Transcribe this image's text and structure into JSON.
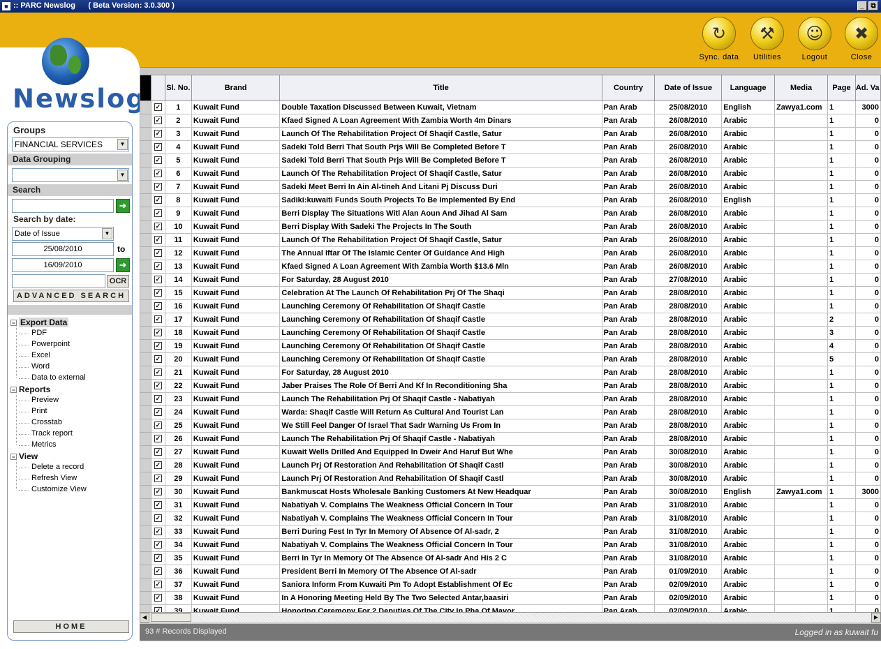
{
  "window": {
    "title": ":: PARC Newslog      ( Beta Version: 3.0.300 )",
    "minimize": "_",
    "restore": "⧉"
  },
  "toolbar": [
    {
      "label": "Sync. data",
      "icon": "sync-icon",
      "glyph": "↻"
    },
    {
      "label": "Utilities",
      "icon": "utilities-icon",
      "glyph": "⚒"
    },
    {
      "label": "Logout",
      "icon": "logout-user-icon",
      "glyph": "☺"
    },
    {
      "label": "Close",
      "icon": "close-files-icon",
      "glyph": "✖"
    }
  ],
  "logo": {
    "text": "Newslog"
  },
  "sidebar": {
    "groups_label": "Groups",
    "groups_value": "FINANCIAL SERVICES",
    "data_grouping_label": "Data Grouping",
    "data_grouping_value": "",
    "search_label": "Search",
    "search_value": "",
    "search_by_date_label": "Search by date:",
    "date_type_value": "Date of Issue",
    "date_from": "25/08/2010",
    "to_label": "to",
    "date_to": "16/09/2010",
    "ocr_value": "",
    "ocr_label": "OCR",
    "advanced_search_label": "ADVANCED SEARCH",
    "home_label": "HOME",
    "tree": {
      "export": {
        "label": "Export Data",
        "items": [
          "PDF",
          "Powerpoint",
          "Excel",
          "Word",
          "Data to external"
        ]
      },
      "reports": {
        "label": "Reports",
        "items": [
          "Preview",
          "Print",
          "Crosstab",
          "Track report",
          "Metrics"
        ]
      },
      "view": {
        "label": "View",
        "items": [
          "Delete a record",
          "Refresh View",
          "Customize View"
        ]
      }
    }
  },
  "grid": {
    "columns": [
      "Sl. No.",
      "Brand",
      "Title",
      "Country",
      "Date of Issue",
      "Language",
      "Media",
      "Page",
      "Ad. Va"
    ],
    "check_glyph": "✓",
    "rows": [
      [
        "1",
        "Kuwait Fund",
        "Double Taxation Discussed Between Kuwait, Vietnam",
        "Pan Arab",
        "25/08/2010",
        "English",
        "Zawya1.com",
        "1",
        "3000"
      ],
      [
        "2",
        "Kuwait Fund",
        "Kfaed Signed A Loan Agreement With Zambia Worth 4m Dinars",
        "Pan Arab",
        "26/08/2010",
        "Arabic",
        "",
        "1",
        "0"
      ],
      [
        "3",
        "Kuwait Fund",
        "Launch Of The Rehabilitation Project Of Shaqif Castle, Satur",
        "Pan Arab",
        "26/08/2010",
        "Arabic",
        "",
        "1",
        "0"
      ],
      [
        "4",
        "Kuwait Fund",
        "Sadeki Told Berri That South Prjs Will Be Completed Before T",
        "Pan Arab",
        "26/08/2010",
        "Arabic",
        "",
        "1",
        "0"
      ],
      [
        "5",
        "Kuwait Fund",
        "Sadeki Told Berri That South Prjs Will Be Completed Before T",
        "Pan Arab",
        "26/08/2010",
        "Arabic",
        "",
        "1",
        "0"
      ],
      [
        "6",
        "Kuwait Fund",
        "Launch Of The Rehabilitation Project Of Shaqif Castle, Satur",
        "Pan Arab",
        "26/08/2010",
        "Arabic",
        "",
        "1",
        "0"
      ],
      [
        "7",
        "Kuwait Fund",
        "Sadeki Meet Berri In Ain Al-tineh And Litani Pj Discuss Duri",
        "Pan Arab",
        "26/08/2010",
        "Arabic",
        "",
        "1",
        "0"
      ],
      [
        "8",
        "Kuwait Fund",
        "Sadiki:kuwaiti Funds South Projects To Be Implemented By End",
        "Pan Arab",
        "26/08/2010",
        "English",
        "",
        "1",
        "0"
      ],
      [
        "9",
        "Kuwait Fund",
        "Berri Display The Situations Witl Alan Aoun And Jihad Al Sam",
        "Pan Arab",
        "26/08/2010",
        "Arabic",
        "",
        "1",
        "0"
      ],
      [
        "10",
        "Kuwait Fund",
        "Berri Display With Sadeki The Projects In The South",
        "Pan Arab",
        "26/08/2010",
        "Arabic",
        "",
        "1",
        "0"
      ],
      [
        "11",
        "Kuwait Fund",
        "Launch Of The Rehabilitation Project Of Shaqif Castle, Satur",
        "Pan Arab",
        "26/08/2010",
        "Arabic",
        "",
        "1",
        "0"
      ],
      [
        "12",
        "Kuwait Fund",
        "The Annual Iftar Of The Islamic Center Of Guidance And High",
        "Pan Arab",
        "26/08/2010",
        "Arabic",
        "",
        "1",
        "0"
      ],
      [
        "13",
        "Kuwait Fund",
        "Kfaed Signed A Loan Agreement With Zambia Worth $13.6 Mln",
        "Pan Arab",
        "26/08/2010",
        "Arabic",
        "",
        "1",
        "0"
      ],
      [
        "14",
        "Kuwait Fund",
        "For Saturday, 28 August 2010",
        "Pan Arab",
        "27/08/2010",
        "Arabic",
        "",
        "1",
        "0"
      ],
      [
        "15",
        "Kuwait Fund",
        "Celebration At The Launch Of Rehabilitation Prj Of The Shaqi",
        "Pan Arab",
        "28/08/2010",
        "Arabic",
        "",
        "1",
        "0"
      ],
      [
        "16",
        "Kuwait Fund",
        "Launching Ceremony Of Rehabilitation Of Shaqif Castle",
        "Pan Arab",
        "28/08/2010",
        "Arabic",
        "",
        "1",
        "0"
      ],
      [
        "17",
        "Kuwait Fund",
        "Launching Ceremony Of Rehabilitation Of Shaqif Castle",
        "Pan Arab",
        "28/08/2010",
        "Arabic",
        "",
        "2",
        "0"
      ],
      [
        "18",
        "Kuwait Fund",
        "Launching Ceremony Of Rehabilitation Of Shaqif Castle",
        "Pan Arab",
        "28/08/2010",
        "Arabic",
        "",
        "3",
        "0"
      ],
      [
        "19",
        "Kuwait Fund",
        "Launching Ceremony Of Rehabilitation Of Shaqif Castle",
        "Pan Arab",
        "28/08/2010",
        "Arabic",
        "",
        "4",
        "0"
      ],
      [
        "20",
        "Kuwait Fund",
        "Launching Ceremony Of Rehabilitation Of Shaqif Castle",
        "Pan Arab",
        "28/08/2010",
        "Arabic",
        "",
        "5",
        "0"
      ],
      [
        "21",
        "Kuwait Fund",
        "For Saturday, 28 August 2010",
        "Pan Arab",
        "28/08/2010",
        "Arabic",
        "",
        "1",
        "0"
      ],
      [
        "22",
        "Kuwait Fund",
        "Jaber Praises The Role Of Berri And Kf In Reconditioning Sha",
        "Pan Arab",
        "28/08/2010",
        "Arabic",
        "",
        "1",
        "0"
      ],
      [
        "23",
        "Kuwait Fund",
        "Launch The Rehabilitation Prj Of Shaqif Castle - Nabatiyah",
        "Pan Arab",
        "28/08/2010",
        "Arabic",
        "",
        "1",
        "0"
      ],
      [
        "24",
        "Kuwait Fund",
        "Warda: Shaqif Castle Will Return As Cultural And Tourist Lan",
        "Pan Arab",
        "28/08/2010",
        "Arabic",
        "",
        "1",
        "0"
      ],
      [
        "25",
        "Kuwait Fund",
        "We Still Feel Danger Of Israel That Sadr Warning Us From In",
        "Pan Arab",
        "28/08/2010",
        "Arabic",
        "",
        "1",
        "0"
      ],
      [
        "26",
        "Kuwait Fund",
        "Launch The Rehabilitation Prj Of Shaqif Castle - Nabatiyah",
        "Pan Arab",
        "28/08/2010",
        "Arabic",
        "",
        "1",
        "0"
      ],
      [
        "27",
        "Kuwait Fund",
        "Kuwait Wells Drilled And Equipped In Dweir And Haruf But Whe",
        "Pan Arab",
        "30/08/2010",
        "Arabic",
        "",
        "1",
        "0"
      ],
      [
        "28",
        "Kuwait Fund",
        "Launch Prj Of Restoration And Rehabilitation Of Shaqif Castl",
        "Pan Arab",
        "30/08/2010",
        "Arabic",
        "",
        "1",
        "0"
      ],
      [
        "29",
        "Kuwait Fund",
        "Launch Prj Of Restoration And Rehabilitation Of Shaqif Castl",
        "Pan Arab",
        "30/08/2010",
        "Arabic",
        "",
        "1",
        "0"
      ],
      [
        "30",
        "Kuwait Fund",
        "Bankmuscat Hosts Wholesale Banking Customers At New Headquar",
        "Pan Arab",
        "30/08/2010",
        "English",
        "Zawya1.com",
        "1",
        "3000"
      ],
      [
        "31",
        "Kuwait Fund",
        "Nabatiyah V. Complains The Weakness Official Concern In Tour",
        "Pan Arab",
        "31/08/2010",
        "Arabic",
        "",
        "1",
        "0"
      ],
      [
        "32",
        "Kuwait Fund",
        "Nabatiyah V. Complains The Weakness Official Concern In Tour",
        "Pan Arab",
        "31/08/2010",
        "Arabic",
        "",
        "1",
        "0"
      ],
      [
        "33",
        "Kuwait Fund",
        "Berri During Fest In Tyr In Memory Of Absence Of Al-sadr, 2",
        "Pan Arab",
        "31/08/2010",
        "Arabic",
        "",
        "1",
        "0"
      ],
      [
        "34",
        "Kuwait Fund",
        "Nabatiyah V. Complains The Weakness Official Concern In Tour",
        "Pan Arab",
        "31/08/2010",
        "Arabic",
        "",
        "1",
        "0"
      ],
      [
        "35",
        "Kuwait Fund",
        "Berri In Tyr In Memory Of The Absence Of Al-sadr And His 2 C",
        "Pan Arab",
        "31/08/2010",
        "Arabic",
        "",
        "1",
        "0"
      ],
      [
        "36",
        "Kuwait Fund",
        "President Berri In Memory Of The Absence Of Al-sadr",
        "Pan Arab",
        "01/09/2010",
        "Arabic",
        "",
        "1",
        "0"
      ],
      [
        "37",
        "Kuwait Fund",
        "Saniora Inform From Kuwaiti Pm To Adopt Establishment Of Ec",
        "Pan Arab",
        "02/09/2010",
        "Arabic",
        "",
        "1",
        "0"
      ],
      [
        "38",
        "Kuwait Fund",
        "In A Honoring Meeting Held By The Two Selected Antar,baasiri",
        "Pan Arab",
        "02/09/2010",
        "Arabic",
        "",
        "1",
        "0"
      ],
      [
        "39",
        "Kuwait Fund",
        "Honoring Ceremony For 2 Deputies Of The City In Pha Of Mayor",
        "Pan Arab",
        "02/09/2010",
        "Arabic",
        "",
        "1",
        "0"
      ]
    ]
  },
  "status": {
    "records": "93 # Records Displayed",
    "logged_in": "Logged in as kuwait fu"
  },
  "colors": {
    "header": "#eab010",
    "accent": "#2b5ea8",
    "status": "#777777"
  }
}
